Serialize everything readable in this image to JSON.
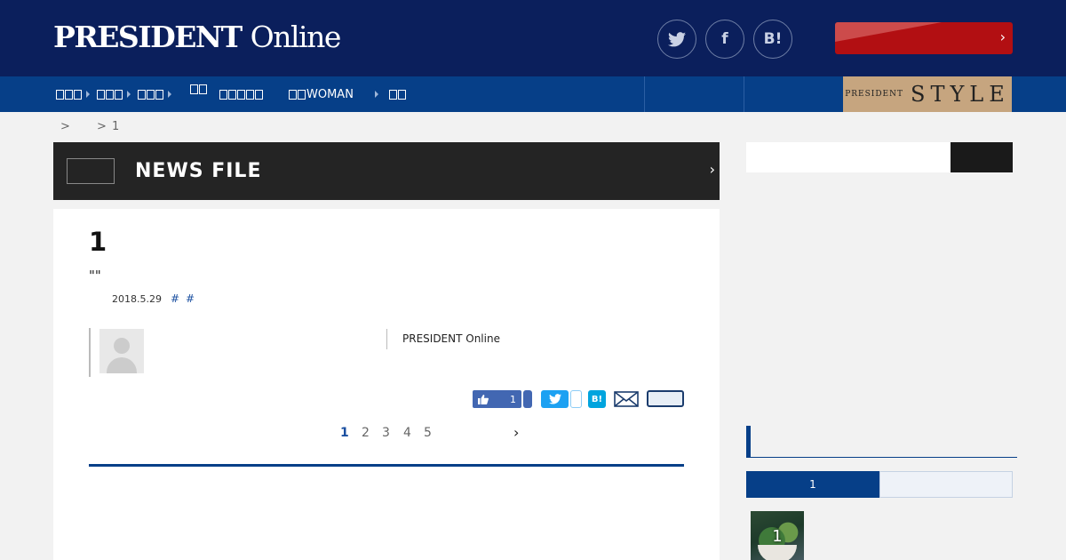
{
  "header": {
    "logo_main": "PRESIDENT",
    "logo_sub": "Online",
    "social": {
      "twitter_icon": "twitter-bird-icon",
      "facebook_label": "f",
      "hatena_label": "B!"
    },
    "cta_chevron": "›",
    "colors": {
      "header_bg": "#0b1f5c",
      "nav_bg": "#063f88",
      "cta_bg": "#b20f12"
    }
  },
  "nav": {
    "items": [
      {
        "label": ""
      },
      {
        "label": ""
      },
      {
        "label": ""
      },
      {
        "label": ""
      },
      {
        "label": ""
      },
      {
        "label": "WOMAN"
      },
      {
        "label": ""
      }
    ],
    "style_small": "PRESIDENT",
    "style_big": "STYLE"
  },
  "breadcrumb": {
    "sep1": ">",
    "sep2": ">",
    "current": "1"
  },
  "banner": {
    "title": "NEWS FILE",
    "chevron": "›"
  },
  "article": {
    "title": "1",
    "subtitle": "\"\"",
    "date": "2018.5.29",
    "tags": [
      "#",
      "#"
    ],
    "source": "PRESIDENT Online",
    "like_count": "1",
    "hatena_label": "B!",
    "pagination": [
      "1",
      "2",
      "3",
      "4",
      "5"
    ],
    "next_chevron": "›"
  },
  "sidebar": {
    "search_placeholder": "",
    "ranking_tab_active": "1",
    "ranking_item_number": "1"
  }
}
